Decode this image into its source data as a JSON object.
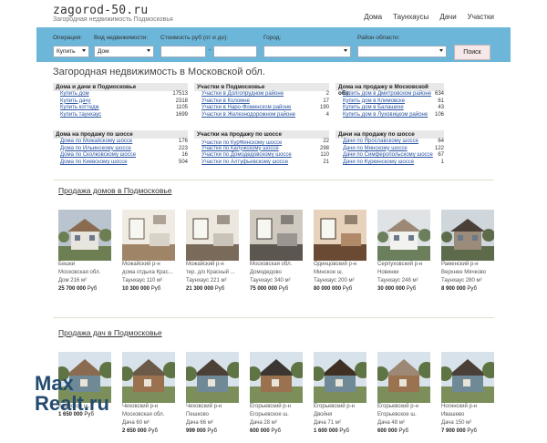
{
  "header": {
    "logo": "zagorod-50.ru",
    "tagline": "Загородная  недвижимость  Подмосковья",
    "nav": [
      "Дома",
      "Таунхаусы",
      "Дачи",
      "Участки"
    ]
  },
  "search": {
    "operation_label": "Операция:",
    "operation_value": "Купить",
    "type_label": "Вид недвижимости:",
    "type_value": "Дом",
    "price_label": "Стоимость руб (от и до):",
    "price_sep": "-",
    "city_label": "Город:",
    "region_label": "Район области:",
    "button": "Поиск"
  },
  "page_title": "Загородная недвижимость в Московской обл.",
  "blocks": [
    {
      "title": "Дома и дачи в Подмосковье",
      "items": [
        {
          "label": "Купить дом",
          "count": "17513"
        },
        {
          "label": "Купить дачу",
          "count": "2318"
        },
        {
          "label": "Купить коттедж",
          "count": "1105"
        },
        {
          "label": "Купить таунхаус",
          "count": "1699"
        }
      ]
    },
    {
      "title": "Участки в Подмосковье",
      "items": [
        {
          "label": "Участки в Долгопрудном районе",
          "count": "2"
        },
        {
          "label": "Участки в Коломне",
          "count": "17"
        },
        {
          "label": "Участки в Наро-Фоминском районе",
          "count": "190"
        },
        {
          "label": "Участки в Железнодорожном районе",
          "count": "4"
        }
      ]
    },
    {
      "title": "Дома на продажу в Московской обл.",
      "items": [
        {
          "label": "Купить дом в Дмитровском районе",
          "count": "634"
        },
        {
          "label": "Купить дом в Климовске",
          "count": "61"
        },
        {
          "label": "Купить дом в Балашихе",
          "count": "43"
        },
        {
          "label": "Купить дом в Луховицком районе",
          "count": "106"
        }
      ]
    },
    {
      "title": "Дома на продажу по шоссе",
      "items": [
        {
          "label": "Дома по Можайскому шоссе",
          "count": "176"
        },
        {
          "label": "Дома по Ильинскому шоссе",
          "count": "223"
        },
        {
          "label": "Дома по Сколковскому шоссе",
          "count": "16"
        },
        {
          "label": "Дома по Киевскому шоссе",
          "count": "504"
        }
      ]
    },
    {
      "title": "Участки на продажу по шоссе",
      "items": [
        {
          "label": "Участки по Курकинскому шоссе",
          "count": "22"
        },
        {
          "label": "Участки по Калужскому шоссе",
          "count": "298"
        },
        {
          "label": "Участки по Домодедовскому шоссе",
          "count": "110"
        },
        {
          "label": "Участки по Алтуфьевскому шоссе",
          "count": "21"
        }
      ]
    },
    {
      "title": "Дачи на продажу по шоссе",
      "items": [
        {
          "label": "Дачи по Ярославскому шоссе",
          "count": "64"
        },
        {
          "label": "Дачи по Минскому шоссе",
          "count": "122"
        },
        {
          "label": "Дачи по Симферопольскому шоссе",
          "count": "67"
        },
        {
          "label": "Дачи по Куркинскому шоссе",
          "count": "1"
        }
      ]
    }
  ],
  "houses_title": "Продажа домов в Подмосковье",
  "houses": [
    {
      "l1": "Бешки",
      "l2": "Московская обл.",
      "l3": "Дом 216 м²",
      "price": "25 700 000",
      "cur": "Руб"
    },
    {
      "l1": "Можайский р-н",
      "l2": "дома отдыха Крас...",
      "l3": "Таунхаус 110 м²",
      "price": "10 300 000",
      "cur": "Руб"
    },
    {
      "l1": "Можайский р-н",
      "l2": "тер. д/о Красный ...",
      "l3": "Таунхаус 221 м²",
      "price": "21 300 000",
      "cur": "Руб"
    },
    {
      "l1": "Московская обл.",
      "l2": "Домодедово",
      "l3": "Таунхаус 340 м²",
      "price": "75 000 000",
      "cur": "Руб"
    },
    {
      "l1": "Одинцовский р-н",
      "l2": "Минское ш.",
      "l3": "Таунхаус 200 м²",
      "price": "80 000 000",
      "cur": "Руб"
    },
    {
      "l1": "Серпуховский р-н",
      "l2": "Новинки",
      "l3": "Таунхаус 248 м²",
      "price": "30 000 000",
      "cur": "Руб"
    },
    {
      "l1": "Раменский р-н",
      "l2": "Верхнее Мячково",
      "l3": "Таунхаус 280 м²",
      "price": "8 900 000",
      "cur": "Руб"
    }
  ],
  "dachas_title": "Продажа дач в Подмосковье",
  "dachas": [
    {
      "l1": "",
      "l2": "Клинское ш.",
      "l3": "",
      "price": "1 650 000",
      "cur": "Руб"
    },
    {
      "l1": "Чеховский р-н",
      "l2": "Московская обл.",
      "l3": "Дача 60 м²",
      "price": "2 650 000",
      "cur": "Руб"
    },
    {
      "l1": "Чеховский р-н",
      "l2": "Пешково",
      "l3": "Дача 66 м²",
      "price": "999 000",
      "cur": "Руб"
    },
    {
      "l1": "Егорьевский р-н",
      "l2": "Егорьевское ш.",
      "l3": "Дача 28 м²",
      "price": "600 000",
      "cur": "Руб"
    },
    {
      "l1": "Егорьевский р-н",
      "l2": "Двойня",
      "l3": "Дача 71 м²",
      "price": "1 600 000",
      "cur": "Руб"
    },
    {
      "l1": "Егорьевский р-н",
      "l2": "Егорьевское ш.",
      "l3": "Дача 48 м²",
      "price": "600 000",
      "cur": "Руб"
    },
    {
      "l1": "Ногинский р-н",
      "l2": "Ивашево",
      "l3": "Дача 150 м²",
      "price": "7 900 000",
      "cur": "Руб"
    }
  ],
  "watermark": {
    "line1": "Max",
    "line2": "Realt.ru"
  }
}
